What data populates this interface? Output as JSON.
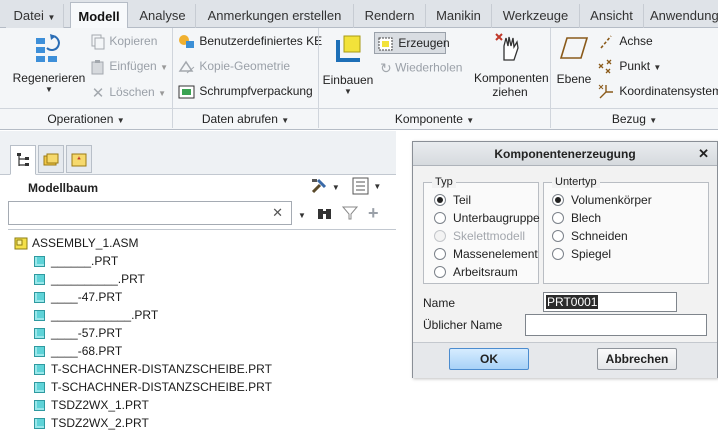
{
  "tabs": [
    {
      "label": "Datei",
      "dropdown": true
    },
    {
      "label": "Modell",
      "active": true
    },
    {
      "label": "Analyse"
    },
    {
      "label": "Anmerkungen erstellen"
    },
    {
      "label": "Rendern"
    },
    {
      "label": "Manikin"
    },
    {
      "label": "Werkzeuge"
    },
    {
      "label": "Ansicht"
    },
    {
      "label": "Anwendungen"
    }
  ],
  "ribbon": {
    "regenerate": "Regenerieren",
    "copy": "Kopieren",
    "paste": "Einfügen",
    "delete": "Löschen",
    "custom_ke": "Benutzerdefiniertes KE",
    "copy_geometry": "Kopie-Geometrie",
    "shrinkwrap": "Schrumpfverpackung",
    "assemble": "Einbauen",
    "create": "Erzeugen",
    "restore": "Wiederholen",
    "drag_components_1": "Komponenten",
    "drag_components_2": "ziehen",
    "plane": "Ebene",
    "axis": "Achse",
    "point": "Punkt",
    "csys": "Koordinatensystem",
    "groups": {
      "operations": "Operationen",
      "get_data": "Daten abrufen",
      "component": "Komponente",
      "datum": "Bezug"
    }
  },
  "panel": {
    "title": "Modellbaum",
    "search_value": "",
    "tree": [
      {
        "label": "ASSEMBLY_1.ASM",
        "kind": "asm"
      },
      {
        "label": "______.PRT",
        "kind": "prt"
      },
      {
        "label": "__________.PRT",
        "kind": "prt"
      },
      {
        "label": "____-47.PRT",
        "kind": "prt"
      },
      {
        "label": "____________.PRT",
        "kind": "prt"
      },
      {
        "label": "____-57.PRT",
        "kind": "prt"
      },
      {
        "label": "____-68.PRT",
        "kind": "prt"
      },
      {
        "label": "T-SCHACHNER-DISTANZSCHEIBE.PRT",
        "kind": "prt"
      },
      {
        "label": "T-SCHACHNER-DISTANZSCHEIBE.PRT",
        "kind": "prt"
      },
      {
        "label": "TSDZ2WX_1.PRT",
        "kind": "prt"
      },
      {
        "label": "TSDZ2WX_2.PRT",
        "kind": "prt"
      }
    ]
  },
  "dialog": {
    "title": "Komponentenerzeugung",
    "type_legend": "Typ",
    "subtype_legend": "Untertyp",
    "types": [
      {
        "label": "Teil",
        "selected": true,
        "enabled": true
      },
      {
        "label": "Unterbaugruppe",
        "selected": false,
        "enabled": true
      },
      {
        "label": "Skelettmodell",
        "selected": false,
        "enabled": false
      },
      {
        "label": "Massenelement",
        "selected": false,
        "enabled": true
      },
      {
        "label": "Arbeitsraum",
        "selected": false,
        "enabled": true
      }
    ],
    "subtypes": [
      {
        "label": "Volumenkörper",
        "selected": true
      },
      {
        "label": "Blech",
        "selected": false
      },
      {
        "label": "Schneiden",
        "selected": false
      },
      {
        "label": "Spiegel",
        "selected": false
      }
    ],
    "name_label": "Name",
    "name_value": "PRT0001",
    "common_name_label": "Üblicher Name",
    "common_name_value": "",
    "ok": "OK",
    "cancel": "Abbrechen"
  }
}
